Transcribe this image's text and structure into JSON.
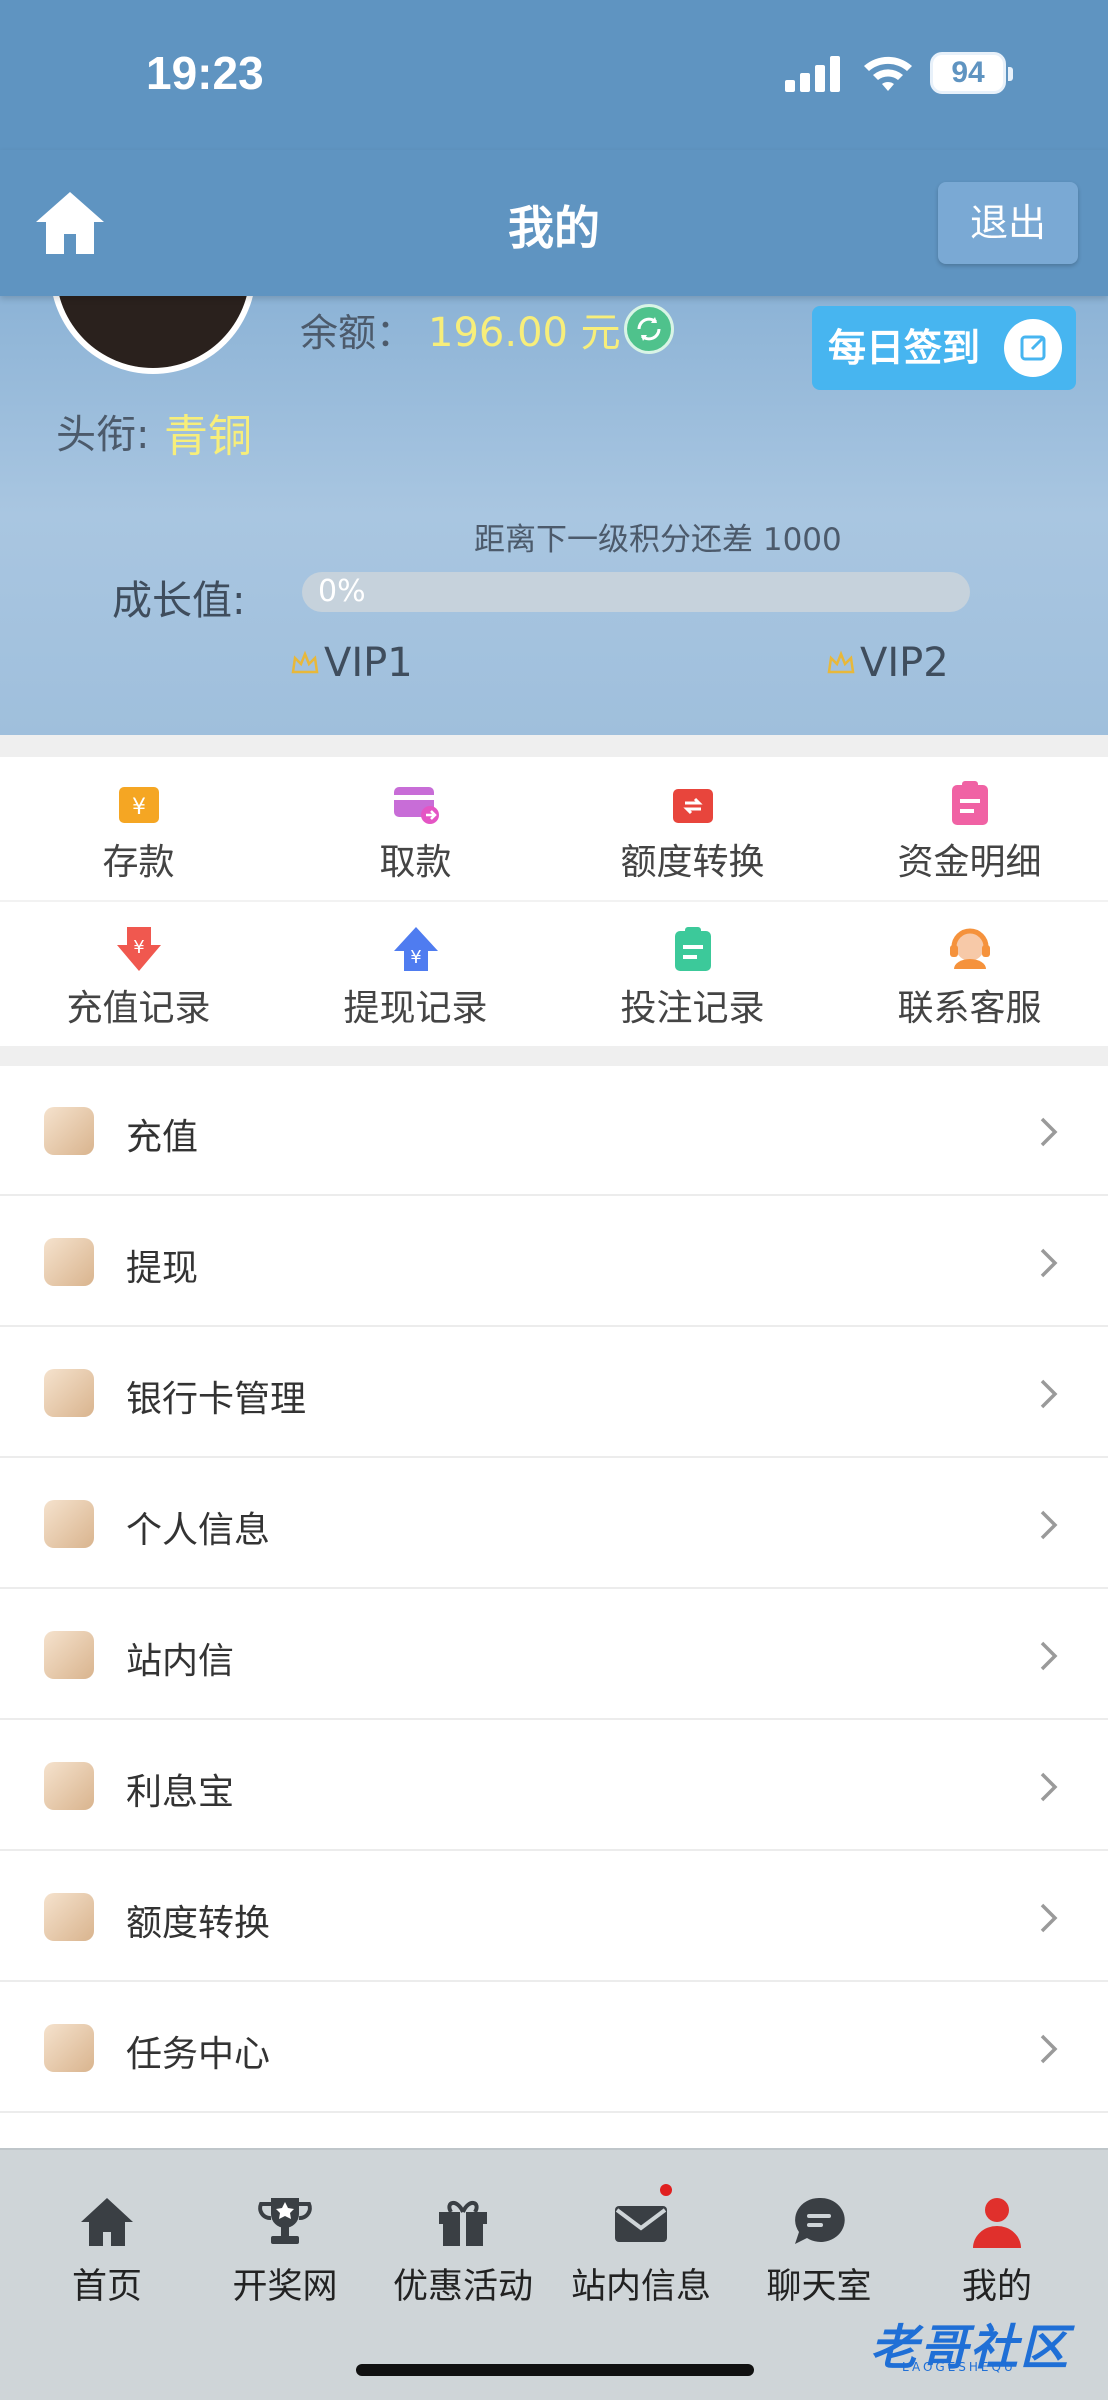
{
  "status_bar": {
    "time": "19:23",
    "battery": "94"
  },
  "nav": {
    "title": "我的",
    "logout": "退出"
  },
  "profile": {
    "balance_label": "余额：",
    "balance_value": "196.00 元",
    "checkin": "每日签到",
    "title_label": "头衔:",
    "title_value": "青铜"
  },
  "growth": {
    "hint": "距离下一级积分还差 1000",
    "label": "成长值:",
    "percent_text": "0%",
    "progress": 0,
    "current_level": "VIP1",
    "next_level": "VIP2"
  },
  "quick_actions": [
    {
      "label": "存款",
      "icon": "deposit-icon",
      "color": "#f5a623"
    },
    {
      "label": "取款",
      "icon": "withdraw-card-icon",
      "color": "#c86dd7"
    },
    {
      "label": "额度转换",
      "icon": "transfer-icon",
      "color": "#e8453c"
    },
    {
      "label": "资金明细",
      "icon": "funds-detail-icon",
      "color": "#f062a4"
    },
    {
      "label": "充值记录",
      "icon": "recharge-record-icon",
      "color": "#f0584f"
    },
    {
      "label": "提现记录",
      "icon": "withdraw-record-icon",
      "color": "#4f7cf0"
    },
    {
      "label": "投注记录",
      "icon": "bet-record-icon",
      "color": "#3cc99a"
    },
    {
      "label": "联系客服",
      "icon": "customer-service-icon",
      "color": "#f5923c"
    }
  ],
  "menu": [
    {
      "label": "充值",
      "icon": "recharge-icon"
    },
    {
      "label": "提现",
      "icon": "withdraw-icon"
    },
    {
      "label": "银行卡管理",
      "icon": "bank-card-icon"
    },
    {
      "label": "个人信息",
      "icon": "personal-info-icon"
    },
    {
      "label": "站内信",
      "icon": "inbox-icon"
    },
    {
      "label": "利息宝",
      "icon": "interest-icon"
    },
    {
      "label": "额度转换",
      "icon": "transfer-icon"
    },
    {
      "label": "任务中心",
      "icon": "task-icon"
    }
  ],
  "tabs": [
    {
      "label": "首页",
      "icon": "home-icon"
    },
    {
      "label": "开奖网",
      "icon": "trophy-icon"
    },
    {
      "label": "优惠活动",
      "icon": "gift-icon"
    },
    {
      "label": "站内信息",
      "icon": "mail-icon",
      "badge": true
    },
    {
      "label": "聊天室",
      "icon": "chat-icon"
    },
    {
      "label": "我的",
      "icon": "user-icon",
      "active": true
    }
  ],
  "colors": {
    "header": "#5f94c1",
    "accent_yellow": "#f7ee7a",
    "active_tab": "#e0302c"
  }
}
